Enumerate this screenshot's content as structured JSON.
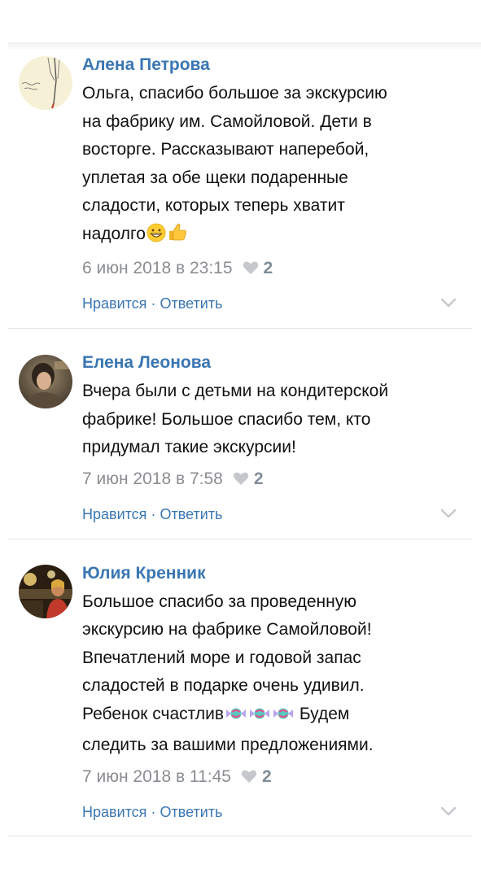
{
  "comments": [
    {
      "author": "Алена Петрова",
      "text_lines": [
        "Ольга, спасибо большое за экскурсию",
        "на фабрику им. Самойловой. Дети в",
        "восторге. Рассказывают наперебой,",
        "уплетая за обе щеки подаренные",
        "сладости, которых теперь хватит",
        "надолго"
      ],
      "emojis": [
        "grinning-face",
        "thumbs-up"
      ],
      "date": "6 июн 2018 в 23:15",
      "likes": "2",
      "like_label": "Нравится",
      "separator": "·",
      "reply_label": "Ответить"
    },
    {
      "author": "Елена Леонова",
      "text_lines": [
        "Вчера были с детьми на кондитерской",
        "фабрике! Большое спасибо тем, кто",
        "придумал такие экскурсии!"
      ],
      "emojis": [],
      "date": "7 июн 2018 в 7:58",
      "likes": "2",
      "like_label": "Нравится",
      "separator": "·",
      "reply_label": "Ответить"
    },
    {
      "author": "Юлия Кренник",
      "text_lines": [
        "Большое спасибо за проведенную",
        "экскурсию на фабрике Самойловой!",
        "Впечатлений море и годовой запас",
        "сладостей в подарке очень удивил.",
        "Ребенок счастлив",
        "Будем",
        "следить за вашими предложениями."
      ],
      "emojis": [
        "candy",
        "candy",
        "candy"
      ],
      "date": "7 июн 2018 в 11:45",
      "likes": "2",
      "like_label": "Нравится",
      "separator": "·",
      "reply_label": "Ответить"
    }
  ],
  "colors": {
    "author": "#3a76b3",
    "link": "#3a76b3",
    "meta": "#8a8d91",
    "divider": "#e4e6ea"
  }
}
